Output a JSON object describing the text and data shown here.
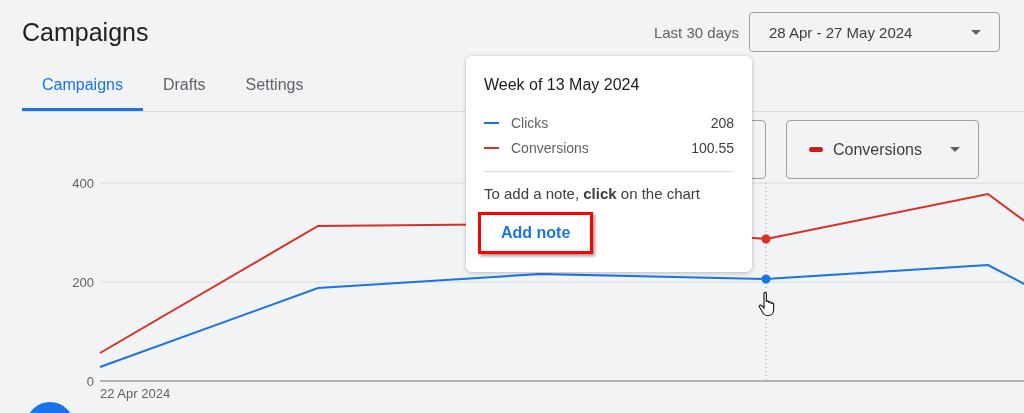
{
  "page_title": "Campaigns",
  "date_range": {
    "label": "Last 30 days",
    "value": "28 Apr - 27 May 2024"
  },
  "tabs": [
    {
      "label": "Campaigns",
      "selected": true
    },
    {
      "label": "Drafts",
      "selected": false
    },
    {
      "label": "Settings",
      "selected": false
    }
  ],
  "metric_selectors": [
    {
      "label": "Conversions",
      "color": "#c5221f"
    }
  ],
  "chart": {
    "y_axis_labels": [
      "400",
      "200",
      "0"
    ],
    "x_axis_label": "22 Apr 2024"
  },
  "tooltip": {
    "title": "Week of 13 May 2024",
    "rows": [
      {
        "label": "Clicks",
        "value": "208",
        "color": "#1a73e8"
      },
      {
        "label": "Conversions",
        "value": "100.55",
        "color": "#d93025"
      }
    ],
    "hint": "To add a note, **click** on the chart",
    "action": "Add note",
    "highlighted": true
  }
}
